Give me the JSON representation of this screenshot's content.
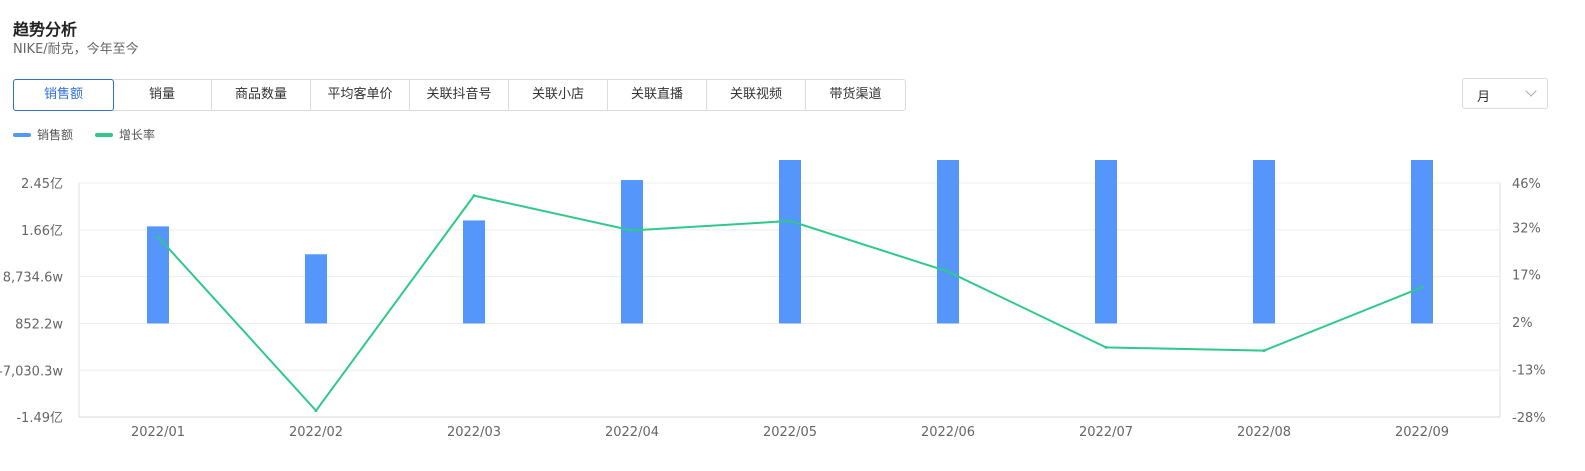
{
  "header": {
    "title": "趋势分析",
    "subtitle": "NIKE/耐克，今年至今"
  },
  "tabs": [
    {
      "label": "销售额",
      "active": true
    },
    {
      "label": "销量",
      "active": false
    },
    {
      "label": "商品数量",
      "active": false
    },
    {
      "label": "平均客单价",
      "active": false
    },
    {
      "label": "关联抖音号",
      "active": false
    },
    {
      "label": "关联小店",
      "active": false
    },
    {
      "label": "关联直播",
      "active": false
    },
    {
      "label": "关联视频",
      "active": false
    },
    {
      "label": "带货渠道",
      "active": false
    }
  ],
  "period_select": {
    "value": "月"
  },
  "legend": [
    {
      "label": "销售额",
      "color": "#5596fb"
    },
    {
      "label": "增长率",
      "color": "#2ec98b"
    }
  ],
  "chart_data": {
    "type": "bar",
    "categories": [
      "2022/01",
      "2022/02",
      "2022/03",
      "2022/04",
      "2022/05",
      "2022/06",
      "2022/07",
      "2022/08",
      "2022/09"
    ],
    "series": [
      {
        "name": "销售额",
        "type": "bar",
        "axis": "left",
        "color": "#5596fb",
        "values": [
          17200,
          12500,
          18200,
          25000,
          35000,
          41000,
          37500,
          34500,
          38700
        ]
      },
      {
        "name": "增长率",
        "type": "line",
        "axis": "right",
        "color": "#2ec98b",
        "values": [
          29,
          -26,
          42,
          31,
          34,
          18,
          -6,
          -7,
          13
        ]
      }
    ],
    "left_axis": {
      "ticks": [
        "2.45亿",
        "1.66亿",
        "8,734.6w",
        "852.2w",
        "-7,030.3w",
        "-1.49亿"
      ],
      "tick_values": [
        24500,
        16600,
        8734.6,
        852.2,
        -7030.3,
        -14900
      ],
      "unit": "万",
      "ylim": [
        -14900,
        24500
      ]
    },
    "right_axis": {
      "ticks": [
        "46%",
        "32%",
        "17%",
        "2%",
        "-13%",
        "-28%"
      ],
      "tick_values": [
        46,
        32,
        17,
        2,
        -13,
        -28
      ],
      "unit": "%",
      "ylim": [
        -28,
        46
      ]
    },
    "grid": true
  }
}
